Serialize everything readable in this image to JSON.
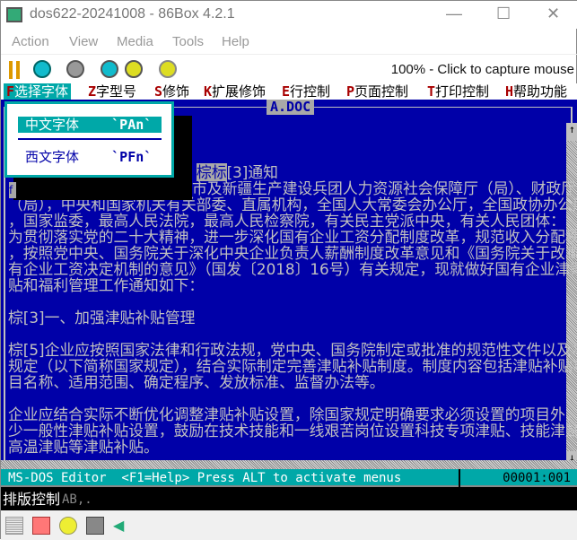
{
  "window": {
    "title": "dos622-20241008 - 86Box 4.2.1",
    "minimize": "—",
    "maximize": "☐",
    "close": "✕"
  },
  "menu": [
    "Action",
    "View",
    "Media",
    "Tools",
    "Help"
  ],
  "toolbar": {
    "icons": [
      "pause-icon",
      "hard-reset-icon",
      "power-icon",
      "ctrl-alt-del-icon",
      "ctrl-alt-esc-icon",
      "settings-icon"
    ],
    "capture_text": "100% - Click to capture mouse"
  },
  "dos_menu": [
    {
      "key": "F",
      "label": "选择字体"
    },
    {
      "key": "Z",
      "label": "字型号"
    },
    {
      "key": "S",
      "label": "修饰"
    },
    {
      "key": "K",
      "label": "扩展修饰"
    },
    {
      "key": "E",
      "label": "行控制"
    },
    {
      "key": "P",
      "label": "页面控制"
    },
    {
      "key": "T",
      "label": "打印控制"
    },
    {
      "key": "H",
      "label": "帮助功能"
    }
  ],
  "dropdown": [
    {
      "label": "中文字体",
      "code": "`PAn`"
    },
    {
      "label": "西文字体",
      "code": "`PFn`"
    }
  ],
  "document": {
    "title": "A.DOC",
    "lines": [
      {
        "mark": "棕标",
        "text": "[3]通知"
      },
      {
        "mark": "f",
        "text": "市及新疆生产建设兵团人力资源社会保障厅（局）、财政厅"
      },
      {
        "text": "（局），中央和国家机关有关部委、直属机构，全国人大常委会办公厅，全国政协办公厅"
      },
      {
        "text": "，国家监委，最高人民法院，最高人民检察院，有关民主党派中央，有关人民团体："
      },
      {
        "text": "为贯彻落实党的二十大精神，进一步深化国有企业工资分配制度改革，规范收入分配秩序"
      },
      {
        "text": "，按照党中央、国务院关于深化中央企业负责人薪酬制度改革意见和《国务院关于改革国"
      },
      {
        "text": "有企业工资决定机制的意见》（国发〔2018〕16号）有关规定，现就做好国有企业津贴补"
      },
      {
        "text": "贴和福利管理工作通知如下："
      },
      {
        "text": ""
      },
      {
        "text": "[3]一、加强津贴补贴管理",
        "mark": "棕"
      },
      {
        "text": ""
      },
      {
        "text": "[5]企业应按照国家法律和行政法规，党中央、国务院制定或批准的规范性文件以及本通",
        "mark": "棕"
      },
      {
        "text": "规定（以下简称国家规定），结合实际制定完善津贴补贴制度。制度内容包括津贴补贴项"
      },
      {
        "text": "目名称、适用范围、确定程序、发放标准、监督办法等。"
      },
      {
        "text": ""
      },
      {
        "text": "企业应结合实际不断优化调整津贴补贴设置，除国家规定明确要求必须设置的项目外，减"
      },
      {
        "text": "少一般性津贴补贴设置，鼓励在技术技能和一线艰苦岗位设置科技专项津贴、技能津贴、"
      },
      {
        "text": "高温津贴等津贴补贴。"
      }
    ]
  },
  "status": {
    "message": "MS-DOS Editor  <F1=Help> Press ALT to activate menus",
    "position": "00001:001"
  },
  "ime": {
    "label": "排版控制",
    "extra": "AB,."
  },
  "statusbar_icons": [
    "hard-disk-icon",
    "floppy-icon",
    "cdrom-icon",
    "network-icon",
    "sound-icon"
  ],
  "colors": {
    "dos_blue": "#0000a8",
    "dos_cyan": "#00a8a8",
    "dos_text": "#c0c0c0",
    "hotkey": "#a80000"
  }
}
